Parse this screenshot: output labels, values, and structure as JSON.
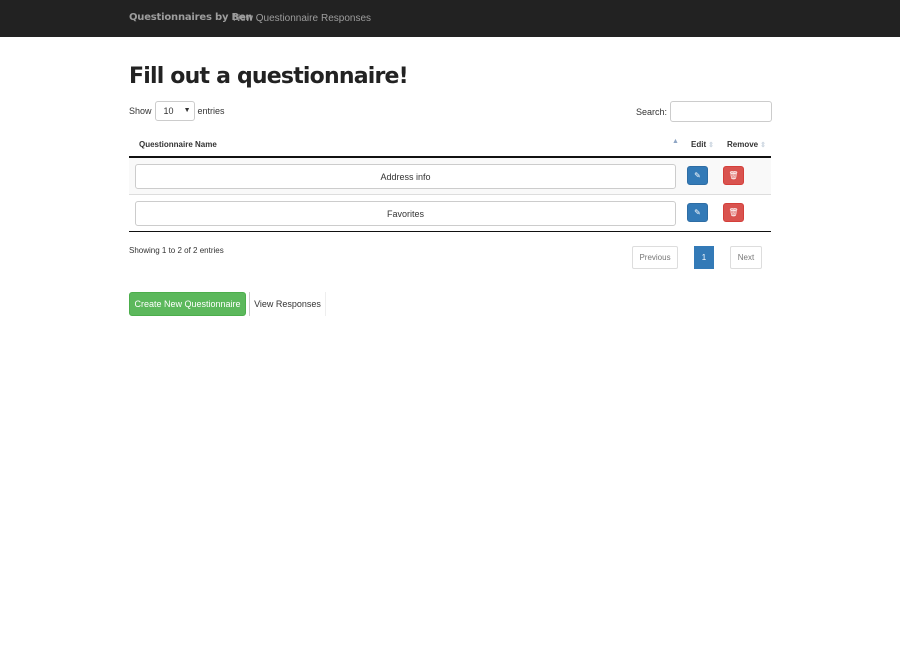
{
  "navbar": {
    "brand": "Questionnaires by Ben",
    "links": [
      "New Questionnaire",
      "Responses"
    ]
  },
  "page": {
    "title": "Fill out a questionnaire!"
  },
  "controls": {
    "show_label": "Show",
    "entries_value": "10",
    "entries_label": "entries",
    "search_label": "Search:",
    "search_value": ""
  },
  "table": {
    "columns": [
      "Questionnaire Name",
      "Edit",
      "Remove"
    ],
    "rows": [
      {
        "name": "Address info"
      },
      {
        "name": "Favorites"
      }
    ]
  },
  "footer": {
    "info": "Showing 1 to 2 of 2 entries",
    "previous": "Previous",
    "current_page": "1",
    "next": "Next"
  },
  "actions": {
    "create": "Create New Questionnaire",
    "view": "View Responses"
  },
  "colors": {
    "navbar": "#222222",
    "primary": "#337ab7",
    "danger": "#d9534f",
    "success": "#5cb85c"
  }
}
